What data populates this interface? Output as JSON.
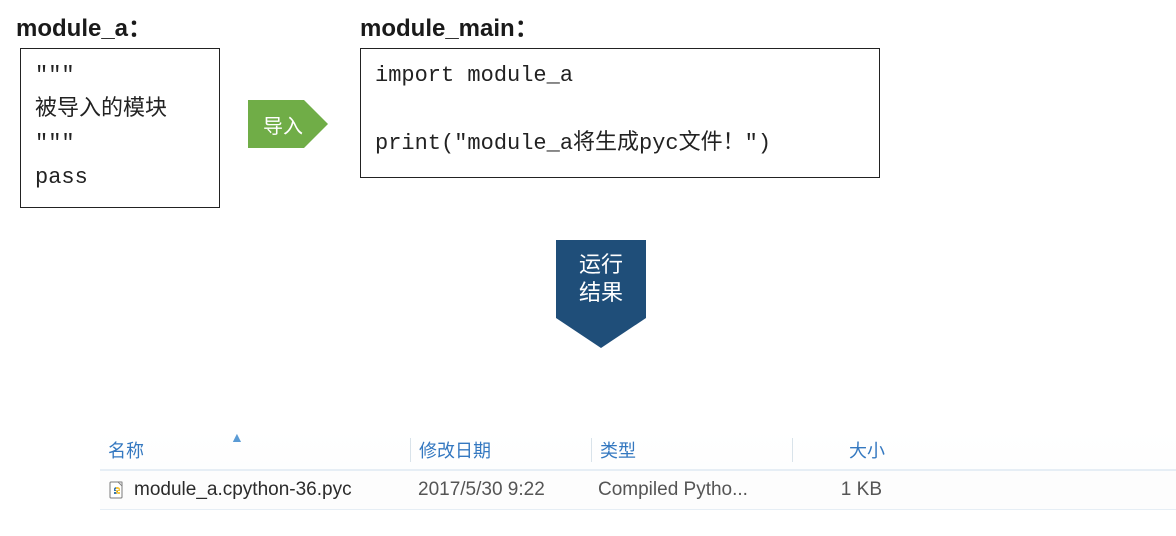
{
  "module_a": {
    "heading": "module_a：",
    "code": "\"\"\"\n被导入的模块\n\"\"\"\npass"
  },
  "module_main": {
    "heading": "module_main：",
    "code": "import module_a\n\nprint(\"module_a将生成pyc文件！\")"
  },
  "arrow": {
    "label": "导入"
  },
  "result": {
    "label": "运行\n结果"
  },
  "file_list": {
    "columns": {
      "name": "名称",
      "modified": "修改日期",
      "type": "类型",
      "size": "大小"
    },
    "rows": [
      {
        "name": "module_a.cpython-36.pyc",
        "modified": "2017/5/30 9:22",
        "type": "Compiled Pytho...",
        "size": "1 KB"
      }
    ]
  }
}
